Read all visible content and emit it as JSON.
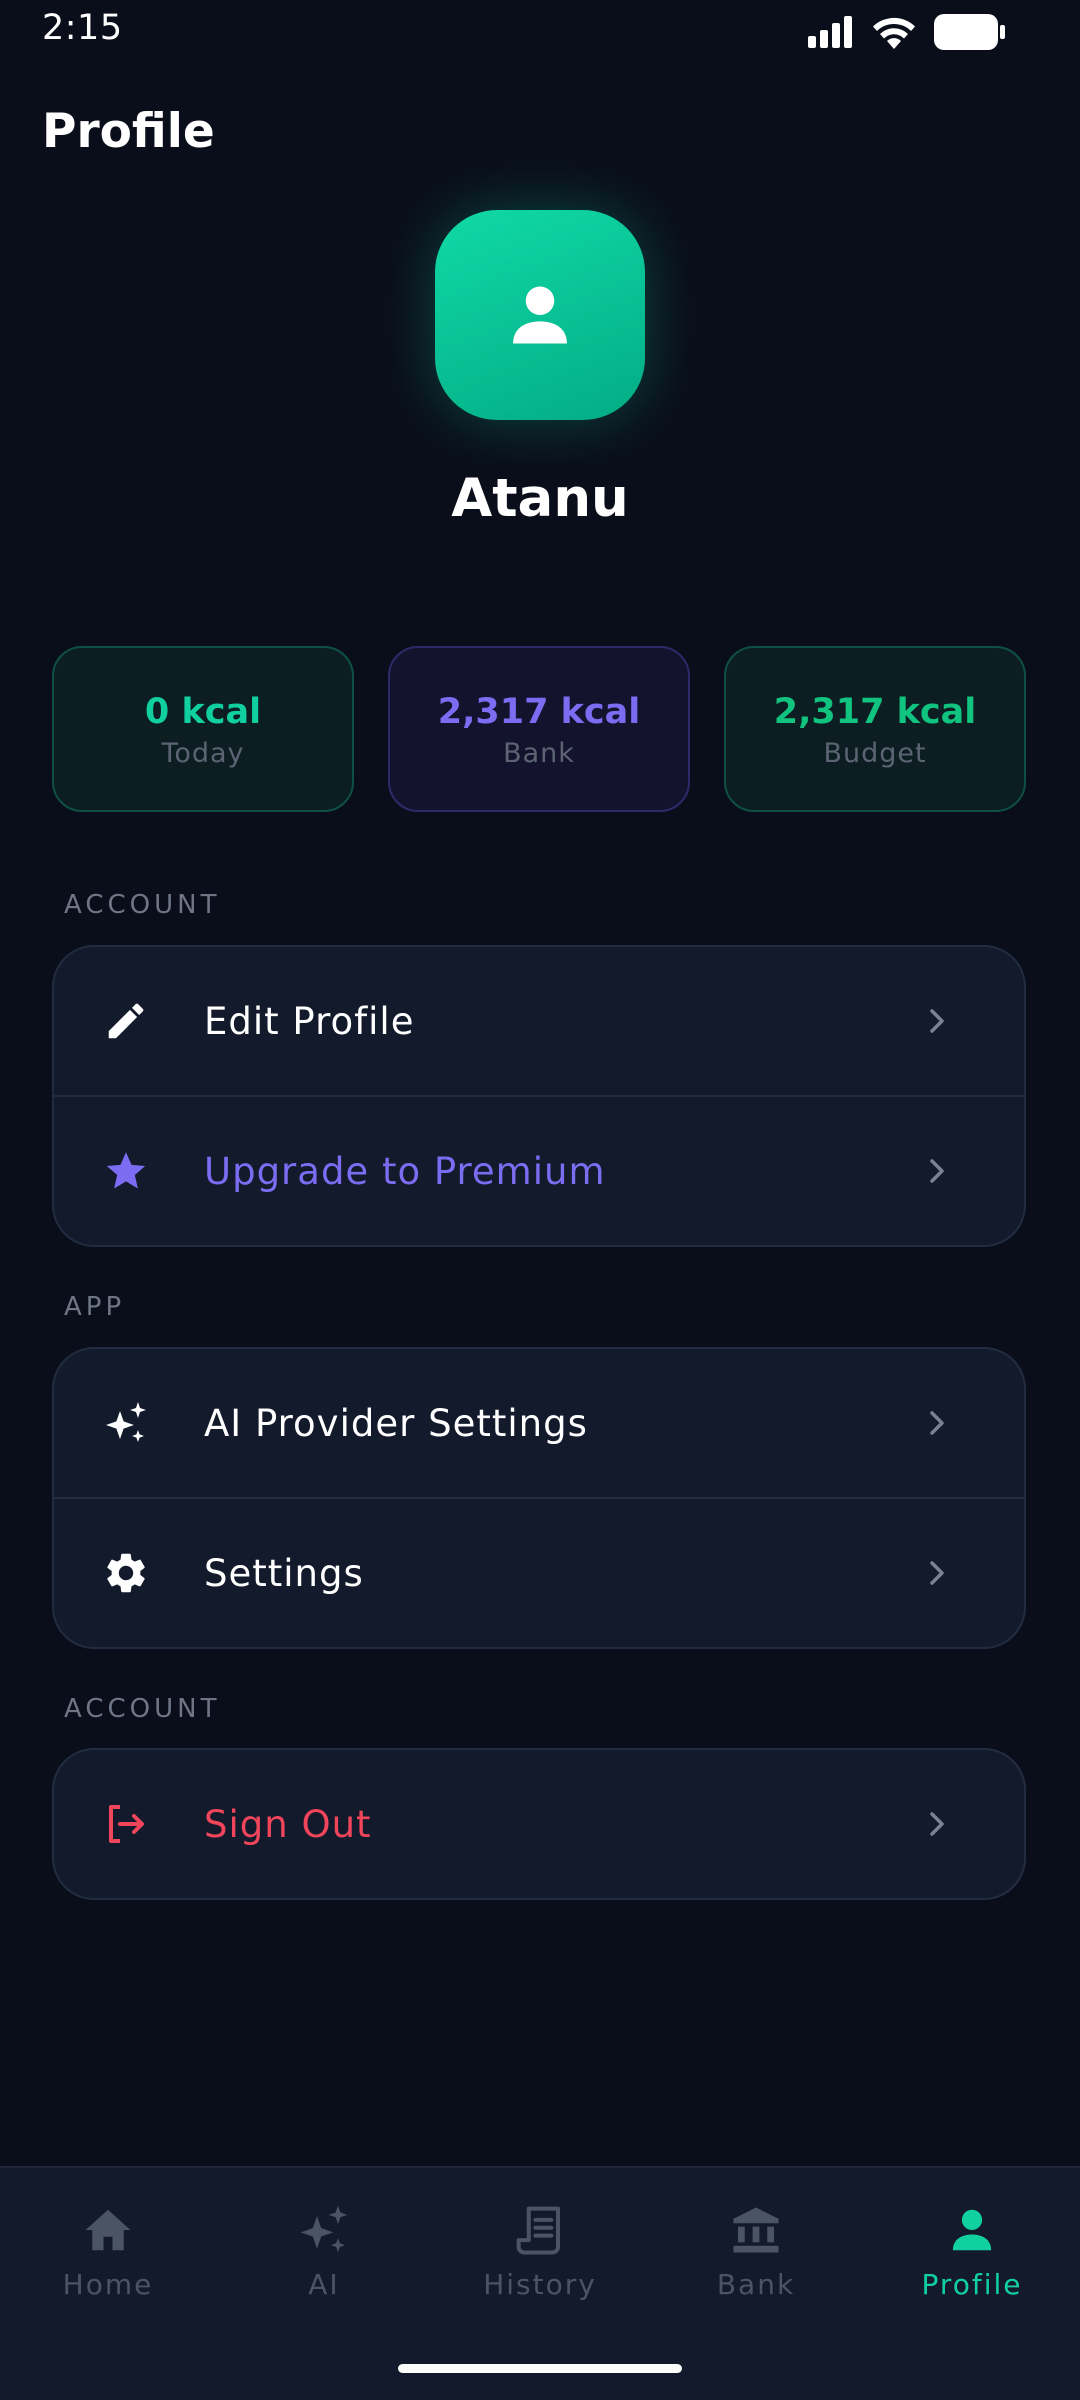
{
  "status_bar": {
    "time": "2:15"
  },
  "header": {
    "title": "Profile"
  },
  "profile": {
    "name": "Atanu",
    "avatar_icon": "user-icon"
  },
  "stats": [
    {
      "value": "0 kcal",
      "label": "Today",
      "color": "#10d0a0"
    },
    {
      "value": "2,317 kcal",
      "label": "Bank",
      "color": "#7c6cf2"
    },
    {
      "value": "2,317 kcal",
      "label": "Budget",
      "color": "#10c37e"
    }
  ],
  "sections": [
    {
      "label": "ACCOUNT",
      "items": [
        {
          "label": "Edit Profile",
          "icon": "pencil-icon",
          "color": "#ffffff"
        },
        {
          "label": "Upgrade to Premium",
          "icon": "star-icon",
          "color": "#7c6cf2"
        }
      ]
    },
    {
      "label": "APP",
      "items": [
        {
          "label": "AI Provider Settings",
          "icon": "sparkles-icon",
          "color": "#ffffff"
        },
        {
          "label": "Settings",
          "icon": "gear-icon",
          "color": "#ffffff"
        }
      ]
    },
    {
      "label": "ACCOUNT",
      "items": [
        {
          "label": "Sign Out",
          "icon": "logout-icon",
          "color": "#f0455a"
        }
      ]
    }
  ],
  "bottom_nav": {
    "items": [
      {
        "label": "Home",
        "icon": "home-icon",
        "active": false
      },
      {
        "label": "AI",
        "icon": "sparkles-icon",
        "active": false
      },
      {
        "label": "History",
        "icon": "receipt-icon",
        "active": false
      },
      {
        "label": "Bank",
        "icon": "bank-icon",
        "active": false
      },
      {
        "label": "Profile",
        "icon": "user-icon",
        "active": true
      }
    ],
    "active_color": "#10d0a0",
    "inactive_color": "#4b5464"
  }
}
